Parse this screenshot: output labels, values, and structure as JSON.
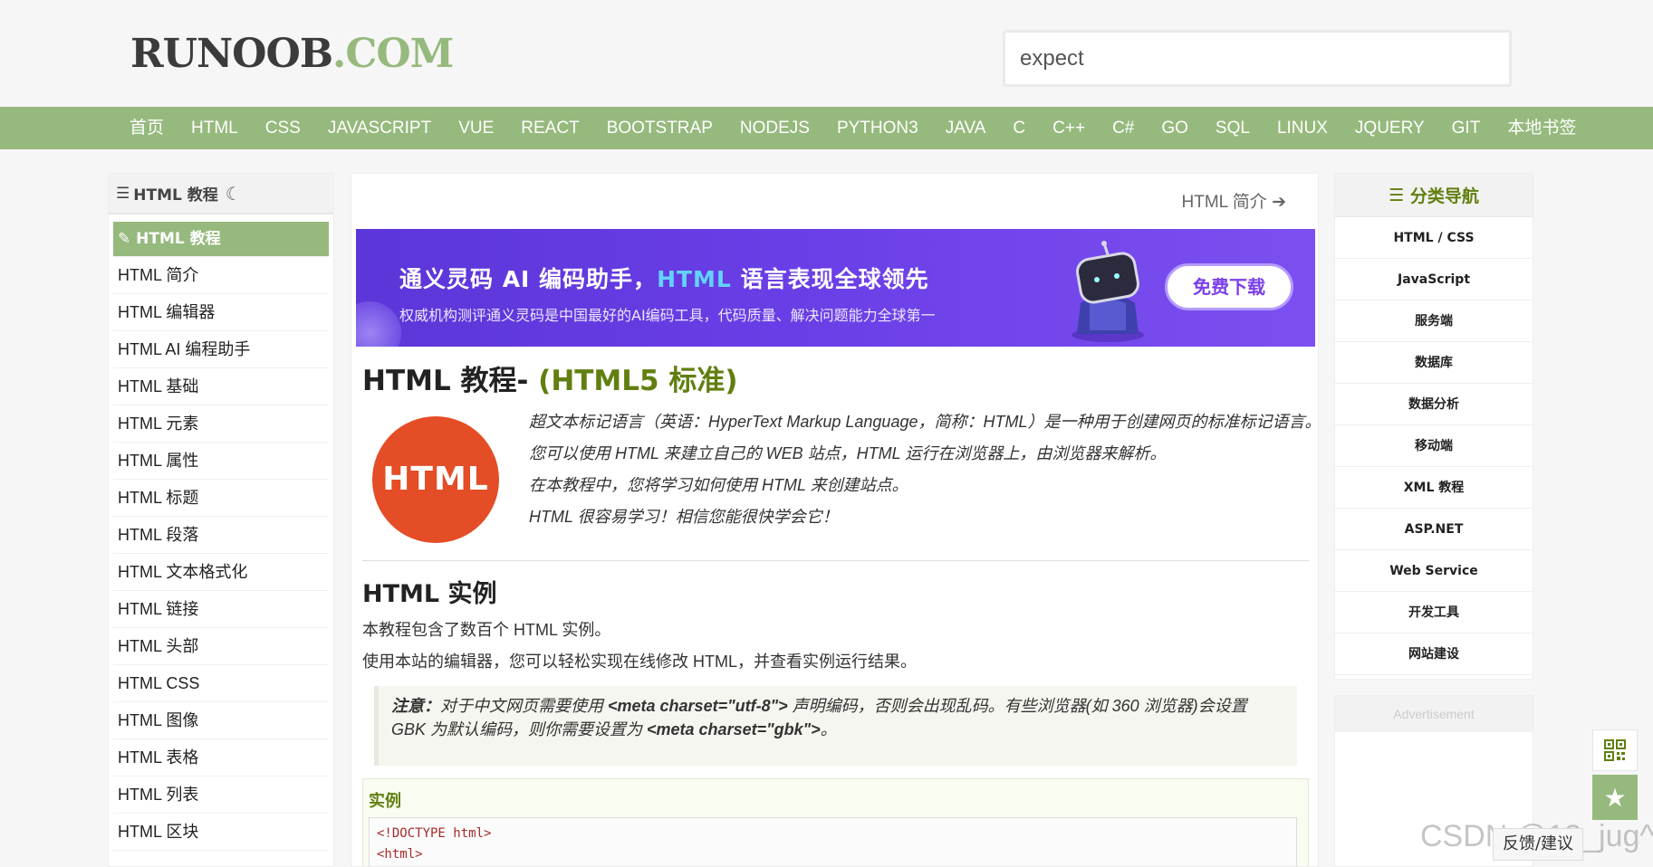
{
  "header": {
    "logo_main": "RUNOOB",
    "logo_suffix": ".COM",
    "search_value": "expect"
  },
  "nav": [
    "首页",
    "HTML",
    "CSS",
    "JAVASCRIPT",
    "VUE",
    "REACT",
    "BOOTSTRAP",
    "NODEJS",
    "PYTHON3",
    "JAVA",
    "C",
    "C++",
    "C#",
    "GO",
    "SQL",
    "LINUX",
    "JQUERY",
    "GIT",
    "本地书签"
  ],
  "sidebar": {
    "title": "HTML 教程",
    "items": [
      "HTML 教程",
      "HTML 简介",
      "HTML 编辑器",
      "HTML AI 编程助手",
      "HTML 基础",
      "HTML 元素",
      "HTML 属性",
      "HTML 标题",
      "HTML 段落",
      "HTML 文本格式化",
      "HTML 链接",
      "HTML 头部",
      "HTML CSS",
      "HTML 图像",
      "HTML 表格",
      "HTML 列表",
      "HTML 区块"
    ]
  },
  "main": {
    "next_link": "HTML 简介",
    "banner": {
      "title_pre": "通义灵码 AI 编码助手，",
      "title_hl": "HTML",
      "title_post": " 语言表现全球领先",
      "subtitle": "权威机构测评通义灵码是中国最好的AI编码工具，代码质量、解决问题能力全球第一",
      "button": "免费下载"
    },
    "h1": "HTML 教程-",
    "h1_green": "(HTML5 标准)",
    "logo_text": "HTML",
    "intro": [
      "超文本标记语言（英语：HyperText Markup Language，简称：HTML）是一种用于创建网页的标准标记语言。",
      "您可以使用 HTML 来建立自己的 WEB 站点，HTML 运行在浏览器上，由浏览器来解析。",
      "在本教程中，您将学习如何使用 HTML 来创建站点。",
      "HTML 很容易学习！相信您能很快学会它！"
    ],
    "h2": "HTML 实例",
    "paras": [
      "本教程包含了数百个 HTML 实例。",
      "使用本站的编辑器，您可以轻松实现在线修改 HTML，并查看实例运行结果。"
    ],
    "note": {
      "label": "注意：",
      "t1": "对于中文网页需要使用 ",
      "code1": "<meta charset=\"utf-8\">",
      "t2": " 声明编码，否则会出现乱码。有些浏览器(如 360 浏览器)会设置 GBK 为默认编码，则你需要设置为 ",
      "code2": "<meta charset=\"gbk\">",
      "t3": "。"
    },
    "example_label": "实例",
    "code_lines": [
      "<!DOCTYPE html>",
      "<html>"
    ]
  },
  "right": {
    "title": "分类导航",
    "items": [
      "HTML / CSS",
      "JavaScript",
      "服务端",
      "数据库",
      "数据分析",
      "移动端",
      "XML 教程",
      "ASP.NET",
      "Web Service",
      "开发工具",
      "网站建设"
    ],
    "ad_label": "Advertisement"
  },
  "widgets": {
    "feedback": "反馈/建议",
    "watermark": "CSDN @13_jug^"
  },
  "colors": {
    "brand_green": "#96b97d",
    "heading_green": "#617f10",
    "banner_purple": "#6a3ee6"
  }
}
